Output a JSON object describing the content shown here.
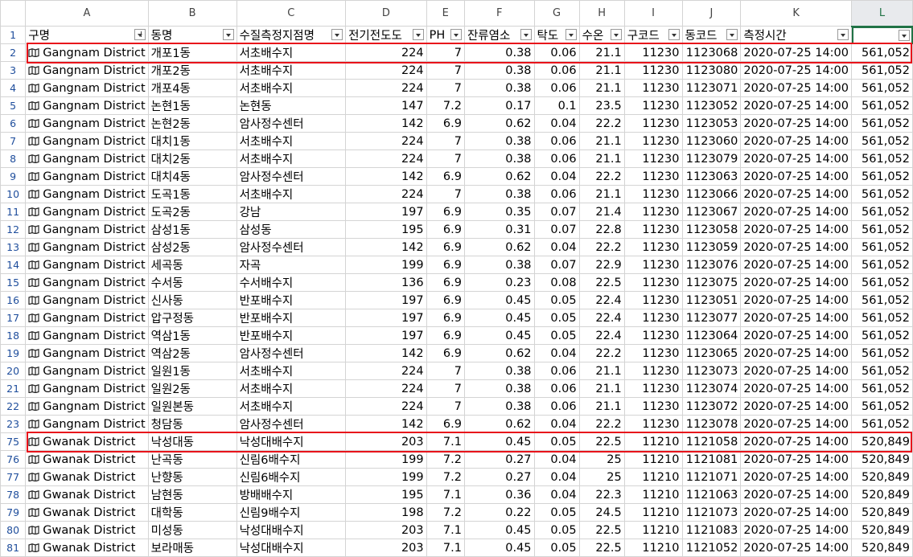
{
  "columns": [
    "A",
    "B",
    "C",
    "D",
    "E",
    "F",
    "G",
    "H",
    "I",
    "J",
    "K",
    "L"
  ],
  "header_row_number": "1",
  "headers": [
    "구명",
    "동명",
    "수질측정지점명",
    "전기전도도",
    "PH",
    "잔류염소",
    "탁도",
    "수온",
    "구코드",
    "동코드",
    "측정시간",
    ""
  ],
  "filtered_column_index": 0,
  "rows": [
    {
      "n": "2",
      "gu": "Gangnam District",
      "dong": "개포1동",
      "site": "서초배수지",
      "ec": "224",
      "ph": "7",
      "cl": "0.38",
      "turb": "0.06",
      "temp": "21.1",
      "gucode": "11230",
      "dongcode": "1123068",
      "time": "2020-07-25 14:00",
      "val": "561,052"
    },
    {
      "n": "3",
      "gu": "Gangnam District",
      "dong": "개포2동",
      "site": "서초배수지",
      "ec": "224",
      "ph": "7",
      "cl": "0.38",
      "turb": "0.06",
      "temp": "21.1",
      "gucode": "11230",
      "dongcode": "1123080",
      "time": "2020-07-25 14:00",
      "val": "561,052"
    },
    {
      "n": "4",
      "gu": "Gangnam District",
      "dong": "개포4동",
      "site": "서초배수지",
      "ec": "224",
      "ph": "7",
      "cl": "0.38",
      "turb": "0.06",
      "temp": "21.1",
      "gucode": "11230",
      "dongcode": "1123071",
      "time": "2020-07-25 14:00",
      "val": "561,052"
    },
    {
      "n": "5",
      "gu": "Gangnam District",
      "dong": "논현1동",
      "site": "논현동",
      "ec": "147",
      "ph": "7.2",
      "cl": "0.17",
      "turb": "0.1",
      "temp": "23.5",
      "gucode": "11230",
      "dongcode": "1123052",
      "time": "2020-07-25 14:00",
      "val": "561,052"
    },
    {
      "n": "6",
      "gu": "Gangnam District",
      "dong": "논현2동",
      "site": "암사정수센터",
      "ec": "142",
      "ph": "6.9",
      "cl": "0.62",
      "turb": "0.04",
      "temp": "22.2",
      "gucode": "11230",
      "dongcode": "1123053",
      "time": "2020-07-25 14:00",
      "val": "561,052"
    },
    {
      "n": "7",
      "gu": "Gangnam District",
      "dong": "대치1동",
      "site": "서초배수지",
      "ec": "224",
      "ph": "7",
      "cl": "0.38",
      "turb": "0.06",
      "temp": "21.1",
      "gucode": "11230",
      "dongcode": "1123060",
      "time": "2020-07-25 14:00",
      "val": "561,052"
    },
    {
      "n": "8",
      "gu": "Gangnam District",
      "dong": "대치2동",
      "site": "서초배수지",
      "ec": "224",
      "ph": "7",
      "cl": "0.38",
      "turb": "0.06",
      "temp": "21.1",
      "gucode": "11230",
      "dongcode": "1123079",
      "time": "2020-07-25 14:00",
      "val": "561,052"
    },
    {
      "n": "9",
      "gu": "Gangnam District",
      "dong": "대치4동",
      "site": "암사정수센터",
      "ec": "142",
      "ph": "6.9",
      "cl": "0.62",
      "turb": "0.04",
      "temp": "22.2",
      "gucode": "11230",
      "dongcode": "1123063",
      "time": "2020-07-25 14:00",
      "val": "561,052"
    },
    {
      "n": "10",
      "gu": "Gangnam District",
      "dong": "도곡1동",
      "site": "서초배수지",
      "ec": "224",
      "ph": "7",
      "cl": "0.38",
      "turb": "0.06",
      "temp": "21.1",
      "gucode": "11230",
      "dongcode": "1123066",
      "time": "2020-07-25 14:00",
      "val": "561,052"
    },
    {
      "n": "11",
      "gu": "Gangnam District",
      "dong": "도곡2동",
      "site": "강남",
      "ec": "197",
      "ph": "6.9",
      "cl": "0.35",
      "turb": "0.07",
      "temp": "21.4",
      "gucode": "11230",
      "dongcode": "1123067",
      "time": "2020-07-25 14:00",
      "val": "561,052"
    },
    {
      "n": "12",
      "gu": "Gangnam District",
      "dong": "삼성1동",
      "site": "삼성동",
      "ec": "195",
      "ph": "6.9",
      "cl": "0.31",
      "turb": "0.07",
      "temp": "22.8",
      "gucode": "11230",
      "dongcode": "1123058",
      "time": "2020-07-25 14:00",
      "val": "561,052"
    },
    {
      "n": "13",
      "gu": "Gangnam District",
      "dong": "삼성2동",
      "site": "암사정수센터",
      "ec": "142",
      "ph": "6.9",
      "cl": "0.62",
      "turb": "0.04",
      "temp": "22.2",
      "gucode": "11230",
      "dongcode": "1123059",
      "time": "2020-07-25 14:00",
      "val": "561,052"
    },
    {
      "n": "14",
      "gu": "Gangnam District",
      "dong": "세곡동",
      "site": "자곡",
      "ec": "199",
      "ph": "6.9",
      "cl": "0.38",
      "turb": "0.07",
      "temp": "22.9",
      "gucode": "11230",
      "dongcode": "1123076",
      "time": "2020-07-25 14:00",
      "val": "561,052"
    },
    {
      "n": "15",
      "gu": "Gangnam District",
      "dong": "수서동",
      "site": "수서배수지",
      "ec": "136",
      "ph": "6.9",
      "cl": "0.23",
      "turb": "0.08",
      "temp": "22.5",
      "gucode": "11230",
      "dongcode": "1123075",
      "time": "2020-07-25 14:00",
      "val": "561,052"
    },
    {
      "n": "16",
      "gu": "Gangnam District",
      "dong": "신사동",
      "site": "반포배수지",
      "ec": "197",
      "ph": "6.9",
      "cl": "0.45",
      "turb": "0.05",
      "temp": "22.4",
      "gucode": "11230",
      "dongcode": "1123051",
      "time": "2020-07-25 14:00",
      "val": "561,052"
    },
    {
      "n": "17",
      "gu": "Gangnam District",
      "dong": "압구정동",
      "site": "반포배수지",
      "ec": "197",
      "ph": "6.9",
      "cl": "0.45",
      "turb": "0.05",
      "temp": "22.4",
      "gucode": "11230",
      "dongcode": "1123077",
      "time": "2020-07-25 14:00",
      "val": "561,052"
    },
    {
      "n": "18",
      "gu": "Gangnam District",
      "dong": "역삼1동",
      "site": "반포배수지",
      "ec": "197",
      "ph": "6.9",
      "cl": "0.45",
      "turb": "0.05",
      "temp": "22.4",
      "gucode": "11230",
      "dongcode": "1123064",
      "time": "2020-07-25 14:00",
      "val": "561,052"
    },
    {
      "n": "19",
      "gu": "Gangnam District",
      "dong": "역삼2동",
      "site": "암사정수센터",
      "ec": "142",
      "ph": "6.9",
      "cl": "0.62",
      "turb": "0.04",
      "temp": "22.2",
      "gucode": "11230",
      "dongcode": "1123065",
      "time": "2020-07-25 14:00",
      "val": "561,052"
    },
    {
      "n": "20",
      "gu": "Gangnam District",
      "dong": "일원1동",
      "site": "서초배수지",
      "ec": "224",
      "ph": "7",
      "cl": "0.38",
      "turb": "0.06",
      "temp": "21.1",
      "gucode": "11230",
      "dongcode": "1123073",
      "time": "2020-07-25 14:00",
      "val": "561,052"
    },
    {
      "n": "21",
      "gu": "Gangnam District",
      "dong": "일원2동",
      "site": "서초배수지",
      "ec": "224",
      "ph": "7",
      "cl": "0.38",
      "turb": "0.06",
      "temp": "21.1",
      "gucode": "11230",
      "dongcode": "1123074",
      "time": "2020-07-25 14:00",
      "val": "561,052"
    },
    {
      "n": "22",
      "gu": "Gangnam District",
      "dong": "일원본동",
      "site": "서초배수지",
      "ec": "224",
      "ph": "7",
      "cl": "0.38",
      "turb": "0.06",
      "temp": "21.1",
      "gucode": "11230",
      "dongcode": "1123072",
      "time": "2020-07-25 14:00",
      "val": "561,052"
    },
    {
      "n": "23",
      "gu": "Gangnam District",
      "dong": "청담동",
      "site": "암사정수센터",
      "ec": "142",
      "ph": "6.9",
      "cl": "0.62",
      "turb": "0.04",
      "temp": "22.2",
      "gucode": "11230",
      "dongcode": "1123078",
      "time": "2020-07-25 14:00",
      "val": "561,052"
    },
    {
      "n": "75",
      "gu": "Gwanak District",
      "dong": "낙성대동",
      "site": "낙성대배수지",
      "ec": "203",
      "ph": "7.1",
      "cl": "0.45",
      "turb": "0.05",
      "temp": "22.5",
      "gucode": "11210",
      "dongcode": "1121058",
      "time": "2020-07-25 14:00",
      "val": "520,849"
    },
    {
      "n": "76",
      "gu": "Gwanak District",
      "dong": "난곡동",
      "site": "신림6배수지",
      "ec": "199",
      "ph": "7.2",
      "cl": "0.27",
      "turb": "0.04",
      "temp": "25",
      "gucode": "11210",
      "dongcode": "1121081",
      "time": "2020-07-25 14:00",
      "val": "520,849"
    },
    {
      "n": "77",
      "gu": "Gwanak District",
      "dong": "난향동",
      "site": "신림6배수지",
      "ec": "199",
      "ph": "7.2",
      "cl": "0.27",
      "turb": "0.04",
      "temp": "25",
      "gucode": "11210",
      "dongcode": "1121071",
      "time": "2020-07-25 14:00",
      "val": "520,849"
    },
    {
      "n": "78",
      "gu": "Gwanak District",
      "dong": "남현동",
      "site": "방배배수지",
      "ec": "195",
      "ph": "7.1",
      "cl": "0.36",
      "turb": "0.04",
      "temp": "22.3",
      "gucode": "11210",
      "dongcode": "1121063",
      "time": "2020-07-25 14:00",
      "val": "520,849"
    },
    {
      "n": "79",
      "gu": "Gwanak District",
      "dong": "대학동",
      "site": "신림9배수지",
      "ec": "198",
      "ph": "7.2",
      "cl": "0.22",
      "turb": "0.05",
      "temp": "24.5",
      "gucode": "11210",
      "dongcode": "1121073",
      "time": "2020-07-25 14:00",
      "val": "520,849"
    },
    {
      "n": "80",
      "gu": "Gwanak District",
      "dong": "미성동",
      "site": "낙성대배수지",
      "ec": "203",
      "ph": "7.1",
      "cl": "0.45",
      "turb": "0.05",
      "temp": "22.5",
      "gucode": "11210",
      "dongcode": "1121083",
      "time": "2020-07-25 14:00",
      "val": "520,849"
    },
    {
      "n": "81",
      "gu": "Gwanak District",
      "dong": "보라매동",
      "site": "낙성대배수지",
      "ec": "203",
      "ph": "7.1",
      "cl": "0.45",
      "turb": "0.05",
      "temp": "22.5",
      "gucode": "11210",
      "dongcode": "1121052",
      "time": "2020-07-25 14:00",
      "val": "520,849"
    }
  ],
  "highlight_rows": [
    "2",
    "75"
  ],
  "colors": {
    "highlight": "#e8131b",
    "selection": "#217346",
    "row_number": "#1f4e9c"
  }
}
